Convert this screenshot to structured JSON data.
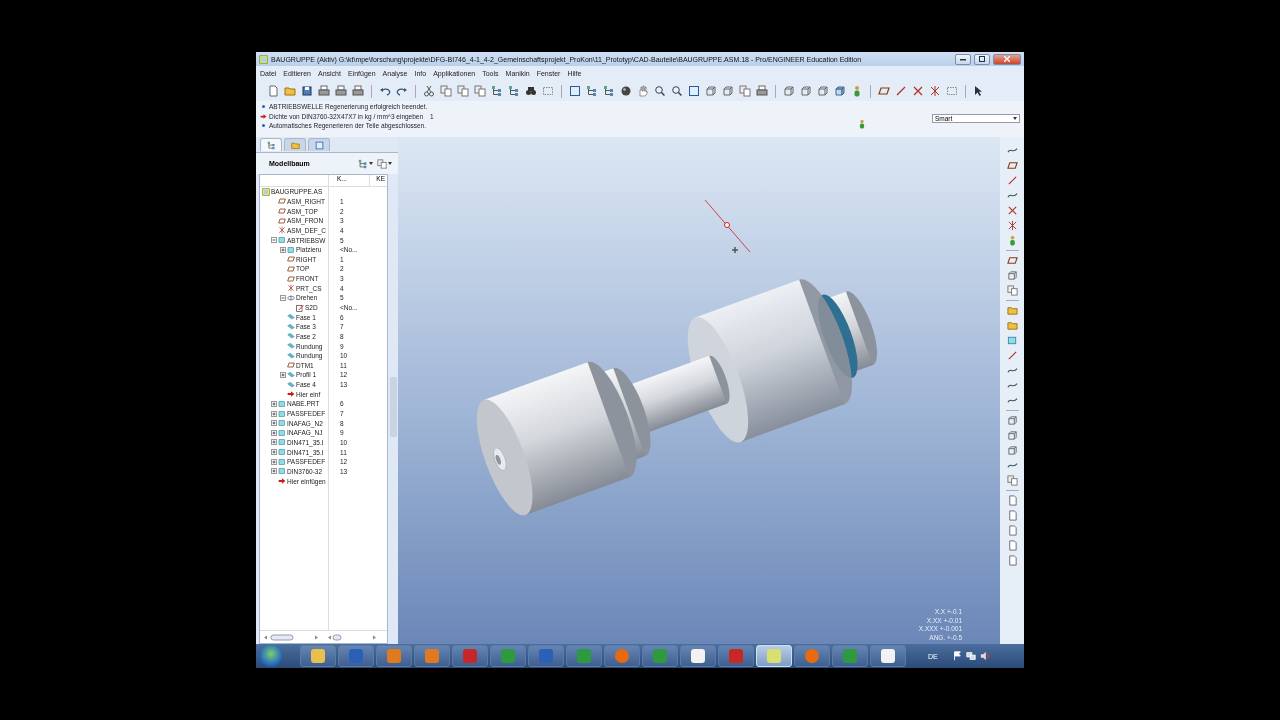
{
  "window": {
    "title": "BAUGRUPPE (Aktiv) G:\\kt\\mpe\\forschung\\projekte\\DFG-BI746_4-1_4-2_Gemeinschaftsprojekt_ProKon\\11_Prototyp\\CAD-Bauteile\\BAUGRUPPE.ASM.18 - Pro/ENGINEER Education Edition"
  },
  "menu": [
    "Datei",
    "Editieren",
    "Ansicht",
    "Einfügen",
    "Analyse",
    "Info",
    "Applikationen",
    "Tools",
    "Manikin",
    "Fenster",
    "Hilfe"
  ],
  "messages": [
    {
      "kind": "info",
      "text": "ABTRIEBSWELLE Regenerierung erfolgreich beendet."
    },
    {
      "kind": "prompt",
      "text": "Dichte von DIN3760-32X47X7 in kg / mm^3 eingeben",
      "value": "1"
    },
    {
      "kind": "info",
      "text": "Automatisches Regenerieren der Teile abgeschlossen."
    }
  ],
  "filter": {
    "value": "Smart"
  },
  "panel_tabs": [
    {
      "kind": "tree",
      "selected": true
    },
    {
      "kind": "folders",
      "selected": false
    },
    {
      "kind": "favorites",
      "selected": false
    }
  ],
  "model_tree": {
    "title": "Modellbaum",
    "columns": [
      "K...",
      "KE"
    ],
    "items": [
      {
        "name": "BAUGRUPPE.AS",
        "kind": "assembly",
        "children": [
          {
            "name": "ASM_RIGHT",
            "number": "1",
            "kind": "plane"
          },
          {
            "name": "ASM_TOP",
            "number": "2",
            "kind": "plane"
          },
          {
            "name": "ASM_FRON",
            "number": "3",
            "kind": "plane"
          },
          {
            "name": "ASM_DEF_C",
            "number": "4",
            "kind": "csys"
          },
          {
            "name": "ABTRIEBSW",
            "number": "5",
            "kind": "part",
            "expanded": true,
            "children": [
              {
                "name": "Platzieru",
                "number": "<No...",
                "kind": "part",
                "expanded": false
              },
              {
                "name": "RIGHT",
                "number": "1",
                "kind": "plane"
              },
              {
                "name": "TOP",
                "number": "2",
                "kind": "plane"
              },
              {
                "name": "FRONT",
                "number": "3",
                "kind": "plane"
              },
              {
                "name": "PRT_CS",
                "number": "4",
                "kind": "csys"
              },
              {
                "name": "Drehen",
                "number": "5",
                "kind": "revolve",
                "expanded": true,
                "children": [
                  {
                    "name": "S2D",
                    "number": "<No...",
                    "kind": "sketch"
                  }
                ]
              },
              {
                "name": "Fase 1",
                "number": "6",
                "kind": "feature"
              },
              {
                "name": "Fase 3",
                "number": "7",
                "kind": "feature"
              },
              {
                "name": "Fase 2",
                "number": "8",
                "kind": "feature"
              },
              {
                "name": "Rundung",
                "number": "9",
                "kind": "feature"
              },
              {
                "name": "Rundung",
                "number": "10",
                "kind": "feature"
              },
              {
                "name": "DTM1",
                "number": "11",
                "kind": "plane"
              },
              {
                "name": "Profil 1",
                "number": "12",
                "kind": "feature",
                "expanded": false
              },
              {
                "name": "Fase 4",
                "number": "13",
                "kind": "feature"
              },
              {
                "name": "Hier einf",
                "kind": "insert"
              }
            ]
          },
          {
            "name": "NABE.PRT",
            "number": "6",
            "kind": "part",
            "expanded": false
          },
          {
            "name": "PASSFEDEF",
            "number": "7",
            "kind": "part",
            "expanded": false
          },
          {
            "name": "INAFAG_N2",
            "number": "8",
            "kind": "part",
            "expanded": false
          },
          {
            "name": "INAFAG_NJ",
            "number": "9",
            "kind": "part",
            "expanded": false
          },
          {
            "name": "DIN471_35.I",
            "number": "10",
            "kind": "part",
            "expanded": false
          },
          {
            "name": "DIN471_35.I",
            "number": "11",
            "kind": "part",
            "expanded": false
          },
          {
            "name": "PASSFEDEF",
            "number": "12",
            "kind": "part",
            "expanded": false
          },
          {
            "name": "DIN3760-32",
            "number": "13",
            "kind": "part",
            "expanded": false
          },
          {
            "name": "Hier einfügen",
            "kind": "insert"
          }
        ]
      }
    ]
  },
  "tolerances": [
    "X.X +-0.1",
    "X.XX +-0.01",
    "X.XXX +-0.001",
    "ANG. +-0.5"
  ],
  "taskbar": {
    "apps": [
      {
        "kind": "folder",
        "selected": false
      },
      {
        "kind": "blue",
        "selected": false
      },
      {
        "kind": "orange",
        "selected": false
      },
      {
        "kind": "orange",
        "selected": false
      },
      {
        "kind": "red",
        "selected": false
      },
      {
        "kind": "green",
        "selected": false
      },
      {
        "kind": "blue",
        "selected": false
      },
      {
        "kind": "green",
        "selected": false
      },
      {
        "kind": "globe",
        "selected": false
      },
      {
        "kind": "green",
        "selected": false
      },
      {
        "kind": "white",
        "selected": false
      },
      {
        "kind": "red",
        "selected": false
      },
      {
        "kind": "yellow",
        "selected": true
      },
      {
        "kind": "globe",
        "selected": false
      },
      {
        "kind": "green",
        "selected": false
      },
      {
        "kind": "white",
        "selected": false
      }
    ],
    "language": "DE"
  }
}
